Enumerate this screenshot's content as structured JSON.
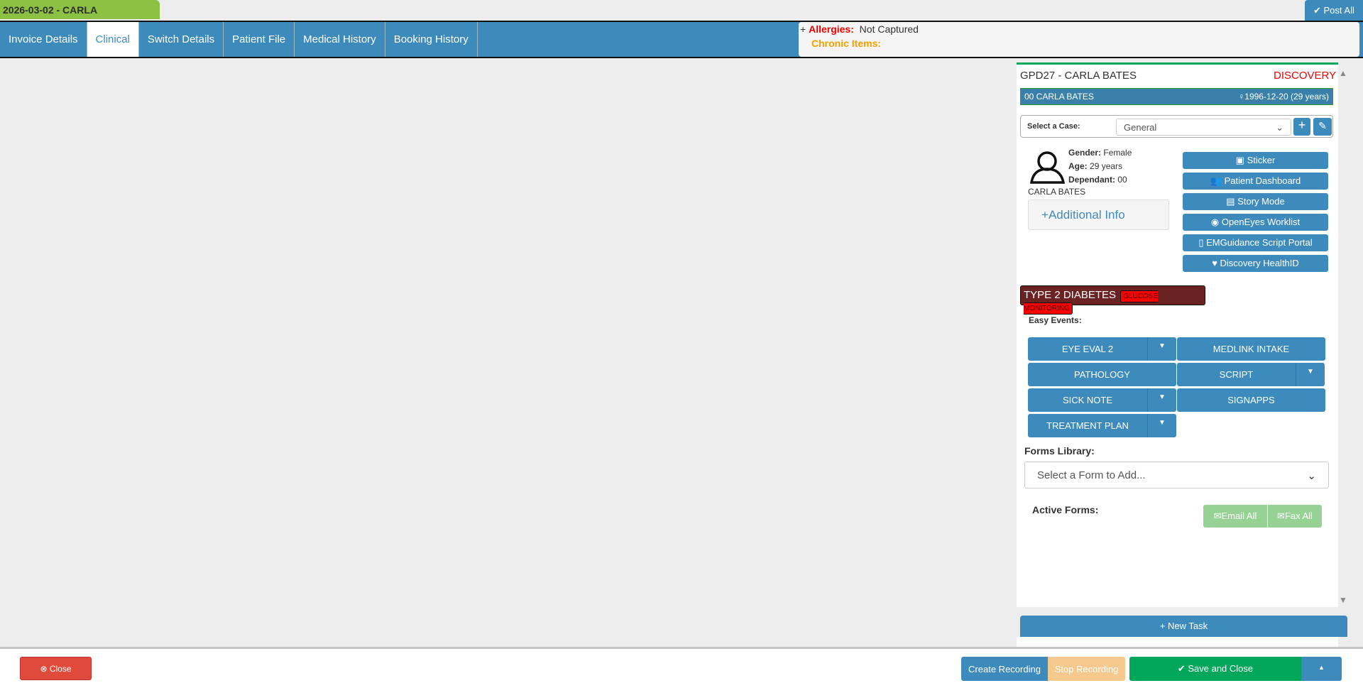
{
  "header": {
    "date_label": "2026-03-02 - CARLA",
    "post_all": "Post All"
  },
  "tabs": [
    {
      "label": "Invoice Details"
    },
    {
      "label": "Clinical"
    },
    {
      "label": "Switch Details"
    },
    {
      "label": "Patient File"
    },
    {
      "label": "Medical History"
    },
    {
      "label": "Booking History"
    }
  ],
  "alerts": {
    "plus": "+",
    "allergies_label": "Allergies:",
    "allergies_value": "Not Captured",
    "chronic_label": "Chronic Items:"
  },
  "patient": {
    "title": "GPD27 - CARLA BATES",
    "scheme": "DISCOVERY",
    "bar_name": "00 CARLA BATES",
    "dob": "1996-12-20 (29 years)",
    "case_label": "Select a Case:",
    "case_value": "General",
    "gender_label": "Gender:",
    "gender": "Female",
    "age_label": "Age:",
    "age": "29 years",
    "dependant_label": "Dependant:",
    "dependant": "00",
    "name": "CARLA BATES",
    "additional_info": "Additional Info"
  },
  "side_buttons": [
    {
      "label": "Sticker"
    },
    {
      "label": "Patient Dashboard"
    },
    {
      "label": "Story Mode"
    },
    {
      "label": "OpenEyes Worklist"
    },
    {
      "label": "EMGuidance Script Portal"
    },
    {
      "label": "Discovery HealthID"
    }
  ],
  "condition": {
    "label": "TYPE 2 DIABETES",
    "tag": "GLUCOSE MONITORING"
  },
  "easy_events": {
    "label": "Easy Events:",
    "items": [
      {
        "label": "EYE EVAL 2"
      },
      {
        "label": "MEDLINK INTAKE"
      },
      {
        "label": "PATHOLOGY"
      },
      {
        "label": "SCRIPT"
      },
      {
        "label": "SICK NOTE"
      },
      {
        "label": "SIGNAPPS"
      },
      {
        "label": "TREATMENT PLAN"
      }
    ]
  },
  "forms": {
    "library_label": "Forms Library:",
    "placeholder": "Select a Form to Add...",
    "active_label": "Active Forms:",
    "email_all": "Email All",
    "fax_all": "Fax All"
  },
  "new_task": "New Task",
  "footer": {
    "close": "Close",
    "create_recording": "Create Recording",
    "stop_recording": "Stop Recording",
    "save_close": "Save and Close"
  }
}
